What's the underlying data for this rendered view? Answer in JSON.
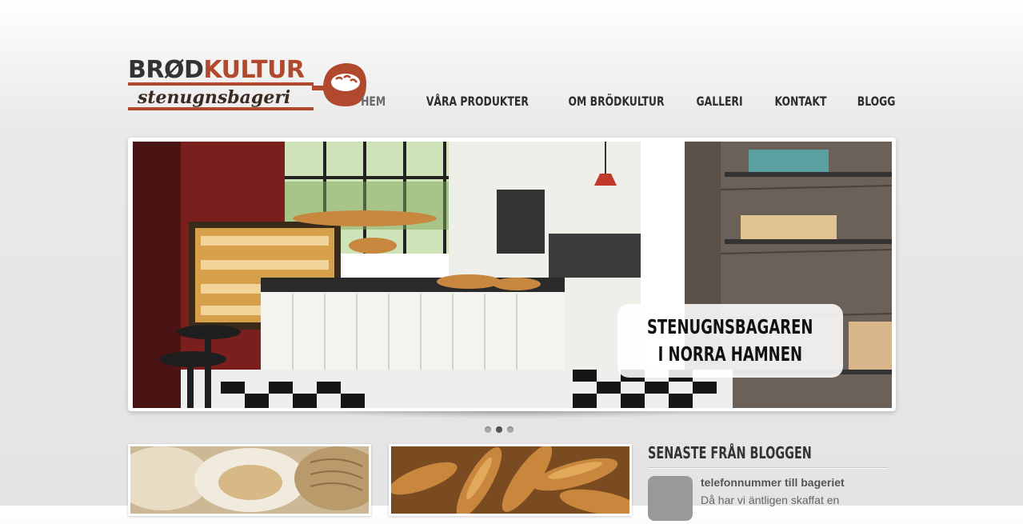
{
  "header": {
    "logo": {
      "title_part1": "BRØD",
      "title_part2": "KULTUR",
      "subtitle": "stenugnsbageri",
      "brand_color": "#b0492e"
    },
    "nav": [
      {
        "label": "HEM",
        "active": true
      },
      {
        "label": "VÅRA PRODUKTER",
        "active": false
      },
      {
        "label": "OM BRÖDKULTUR",
        "active": false
      },
      {
        "label": "GALLERI",
        "active": false
      },
      {
        "label": "KONTAKT",
        "active": false
      },
      {
        "label": "BLOGG",
        "active": false
      }
    ]
  },
  "slider": {
    "caption_line1": "STENUGNSBAGAREN",
    "caption_line2": "I NORRA HAMNEN",
    "slide_count": 3,
    "active_index": 1
  },
  "blog": {
    "heading": "SENASTE FRÅN BLOGGEN",
    "post": {
      "title": "telefonnummer till bageriet",
      "excerpt": "Då har vi äntligen skaffat en"
    }
  },
  "colors": {
    "brand": "#b0492e",
    "text_dark": "#2e2e2e",
    "nav_active": "#6a6a6a"
  }
}
